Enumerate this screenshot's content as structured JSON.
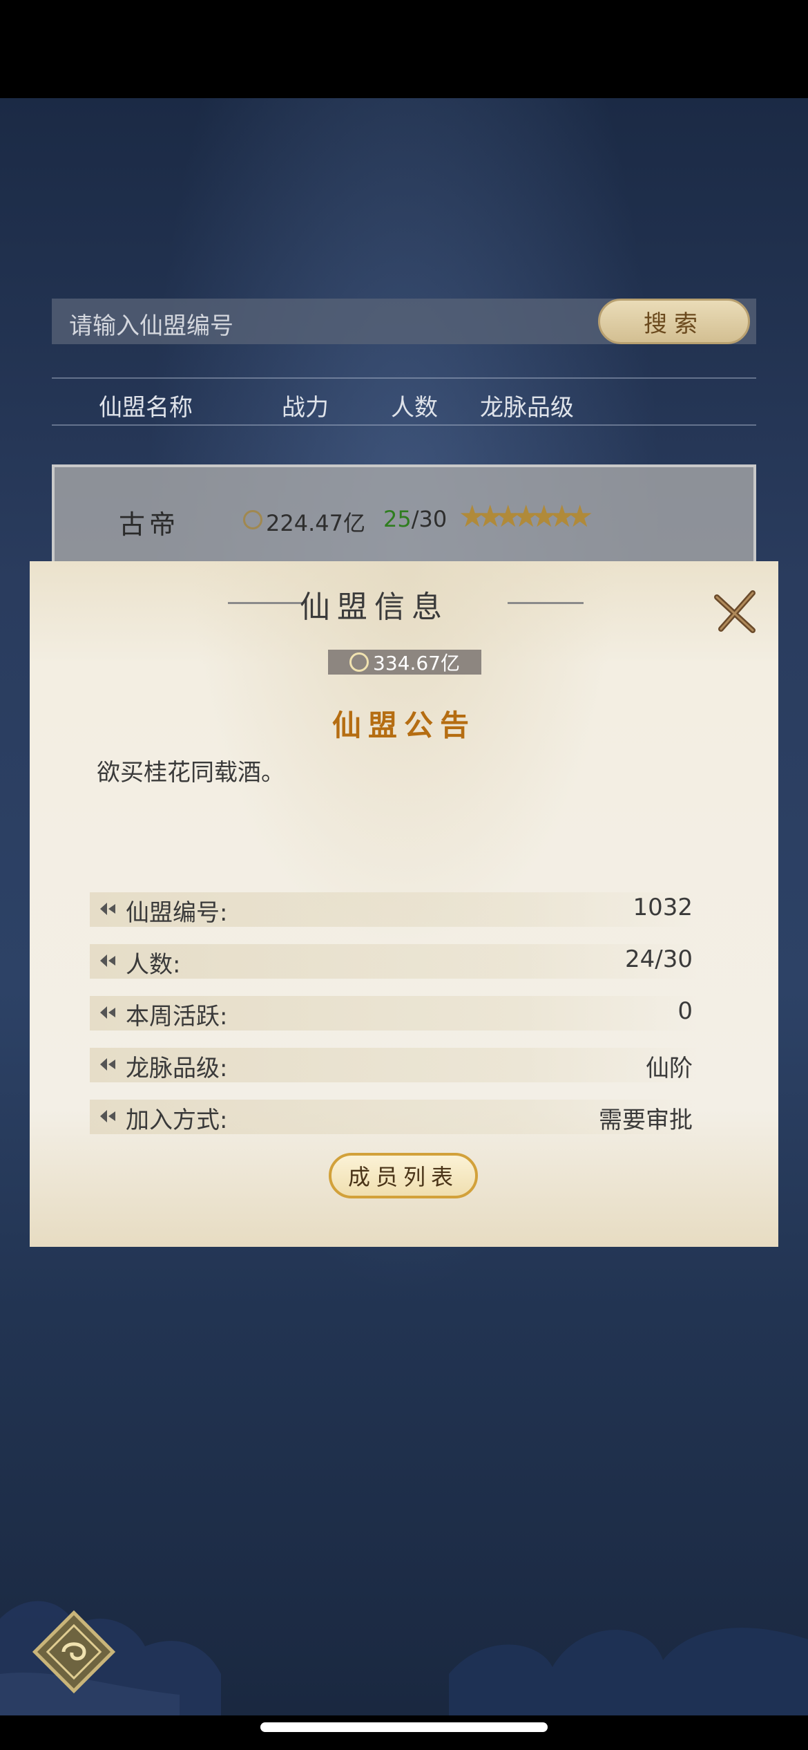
{
  "search": {
    "placeholder": "请输入仙盟编号",
    "button_label": "搜索"
  },
  "table_headers": [
    "仙盟名称",
    "战力",
    "人数",
    "龙脉品级"
  ],
  "alliance_row": {
    "name": "古帝",
    "power": "224.47亿",
    "members_current": "25",
    "members_total": "/30",
    "stars": 7
  },
  "dialog": {
    "title": "仙盟信息",
    "power": "334.67亿",
    "notice_title": "仙盟公告",
    "notice_text": "欲买桂花同载酒。",
    "info": [
      {
        "label": "仙盟编号:",
        "value": "1032"
      },
      {
        "label": "人数:",
        "value": "24/30"
      },
      {
        "label": "本周活跃:",
        "value": "0"
      },
      {
        "label": "龙脉品级:",
        "value": "仙阶"
      },
      {
        "label": "加入方式:",
        "value": "需要审批"
      }
    ],
    "member_list_button": "成员列表"
  },
  "icons": [
    "close-icon",
    "power-icon",
    "star-icon",
    "bullet-icon",
    "menu-icon"
  ],
  "colors": {
    "accent_gold": "#b56d12",
    "member_green": "#2f7d1f"
  }
}
